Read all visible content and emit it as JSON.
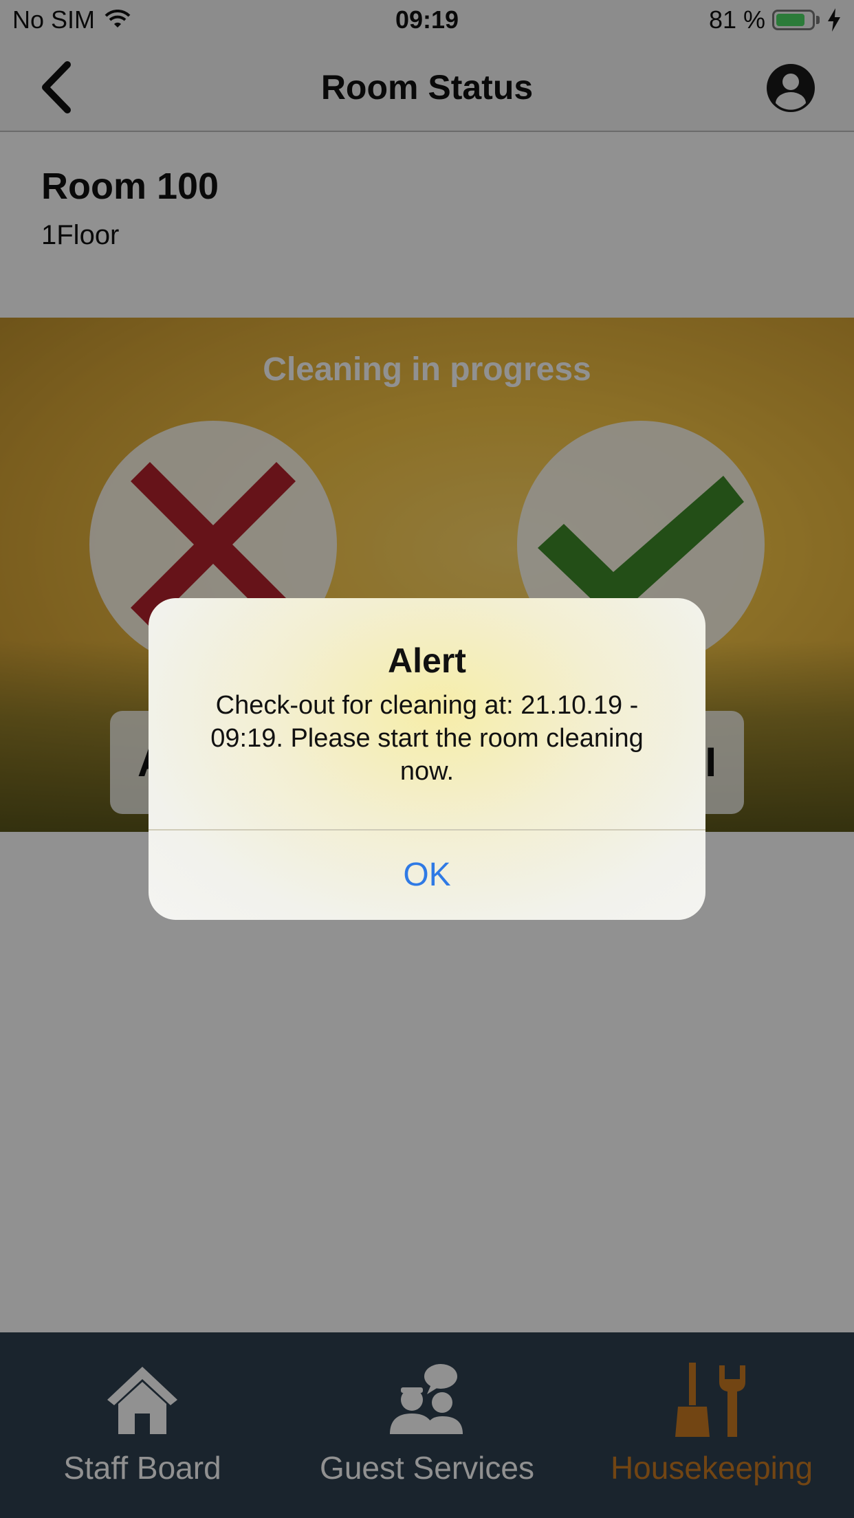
{
  "status_bar": {
    "carrier": "No SIM",
    "time": "09:19",
    "battery_percent_text": "81 %",
    "battery_level": 0.81,
    "battery_color": "#4cd964",
    "icons": [
      "wifi-icon",
      "battery-icon",
      "charging-bolt-icon"
    ]
  },
  "nav": {
    "title": "Room Status",
    "back_icon": "chevron-left-icon",
    "user_icon": "user-circle-icon"
  },
  "room": {
    "name": "Room 100",
    "floor": "1Floor"
  },
  "status_panel": {
    "title": "Cleaning in progress",
    "left_icon": "red-x-icon",
    "right_icon": "green-check-icon",
    "left_button_text": "A",
    "right_button_text": "I",
    "x_color": "#c0392b",
    "check_color": "#3f8a2a"
  },
  "alert": {
    "title": "Alert",
    "message": "Check-out for cleaning at: 21.10.19 - 09:19. Please start the room cleaning now.",
    "ok_label": "OK",
    "ok_color": "#2f7ae5"
  },
  "tabs": [
    {
      "label": "Staff Board",
      "icon": "house-icon",
      "active": false
    },
    {
      "label": "Guest Services",
      "icon": "guest-services-icon",
      "active": false
    },
    {
      "label": "Housekeeping",
      "icon": "broom-wrench-icon",
      "active": true
    }
  ],
  "colors": {
    "tab_active": "#c97a22",
    "tab_inactive": "#ffffff",
    "tabbar_bg": "#2f4050"
  }
}
